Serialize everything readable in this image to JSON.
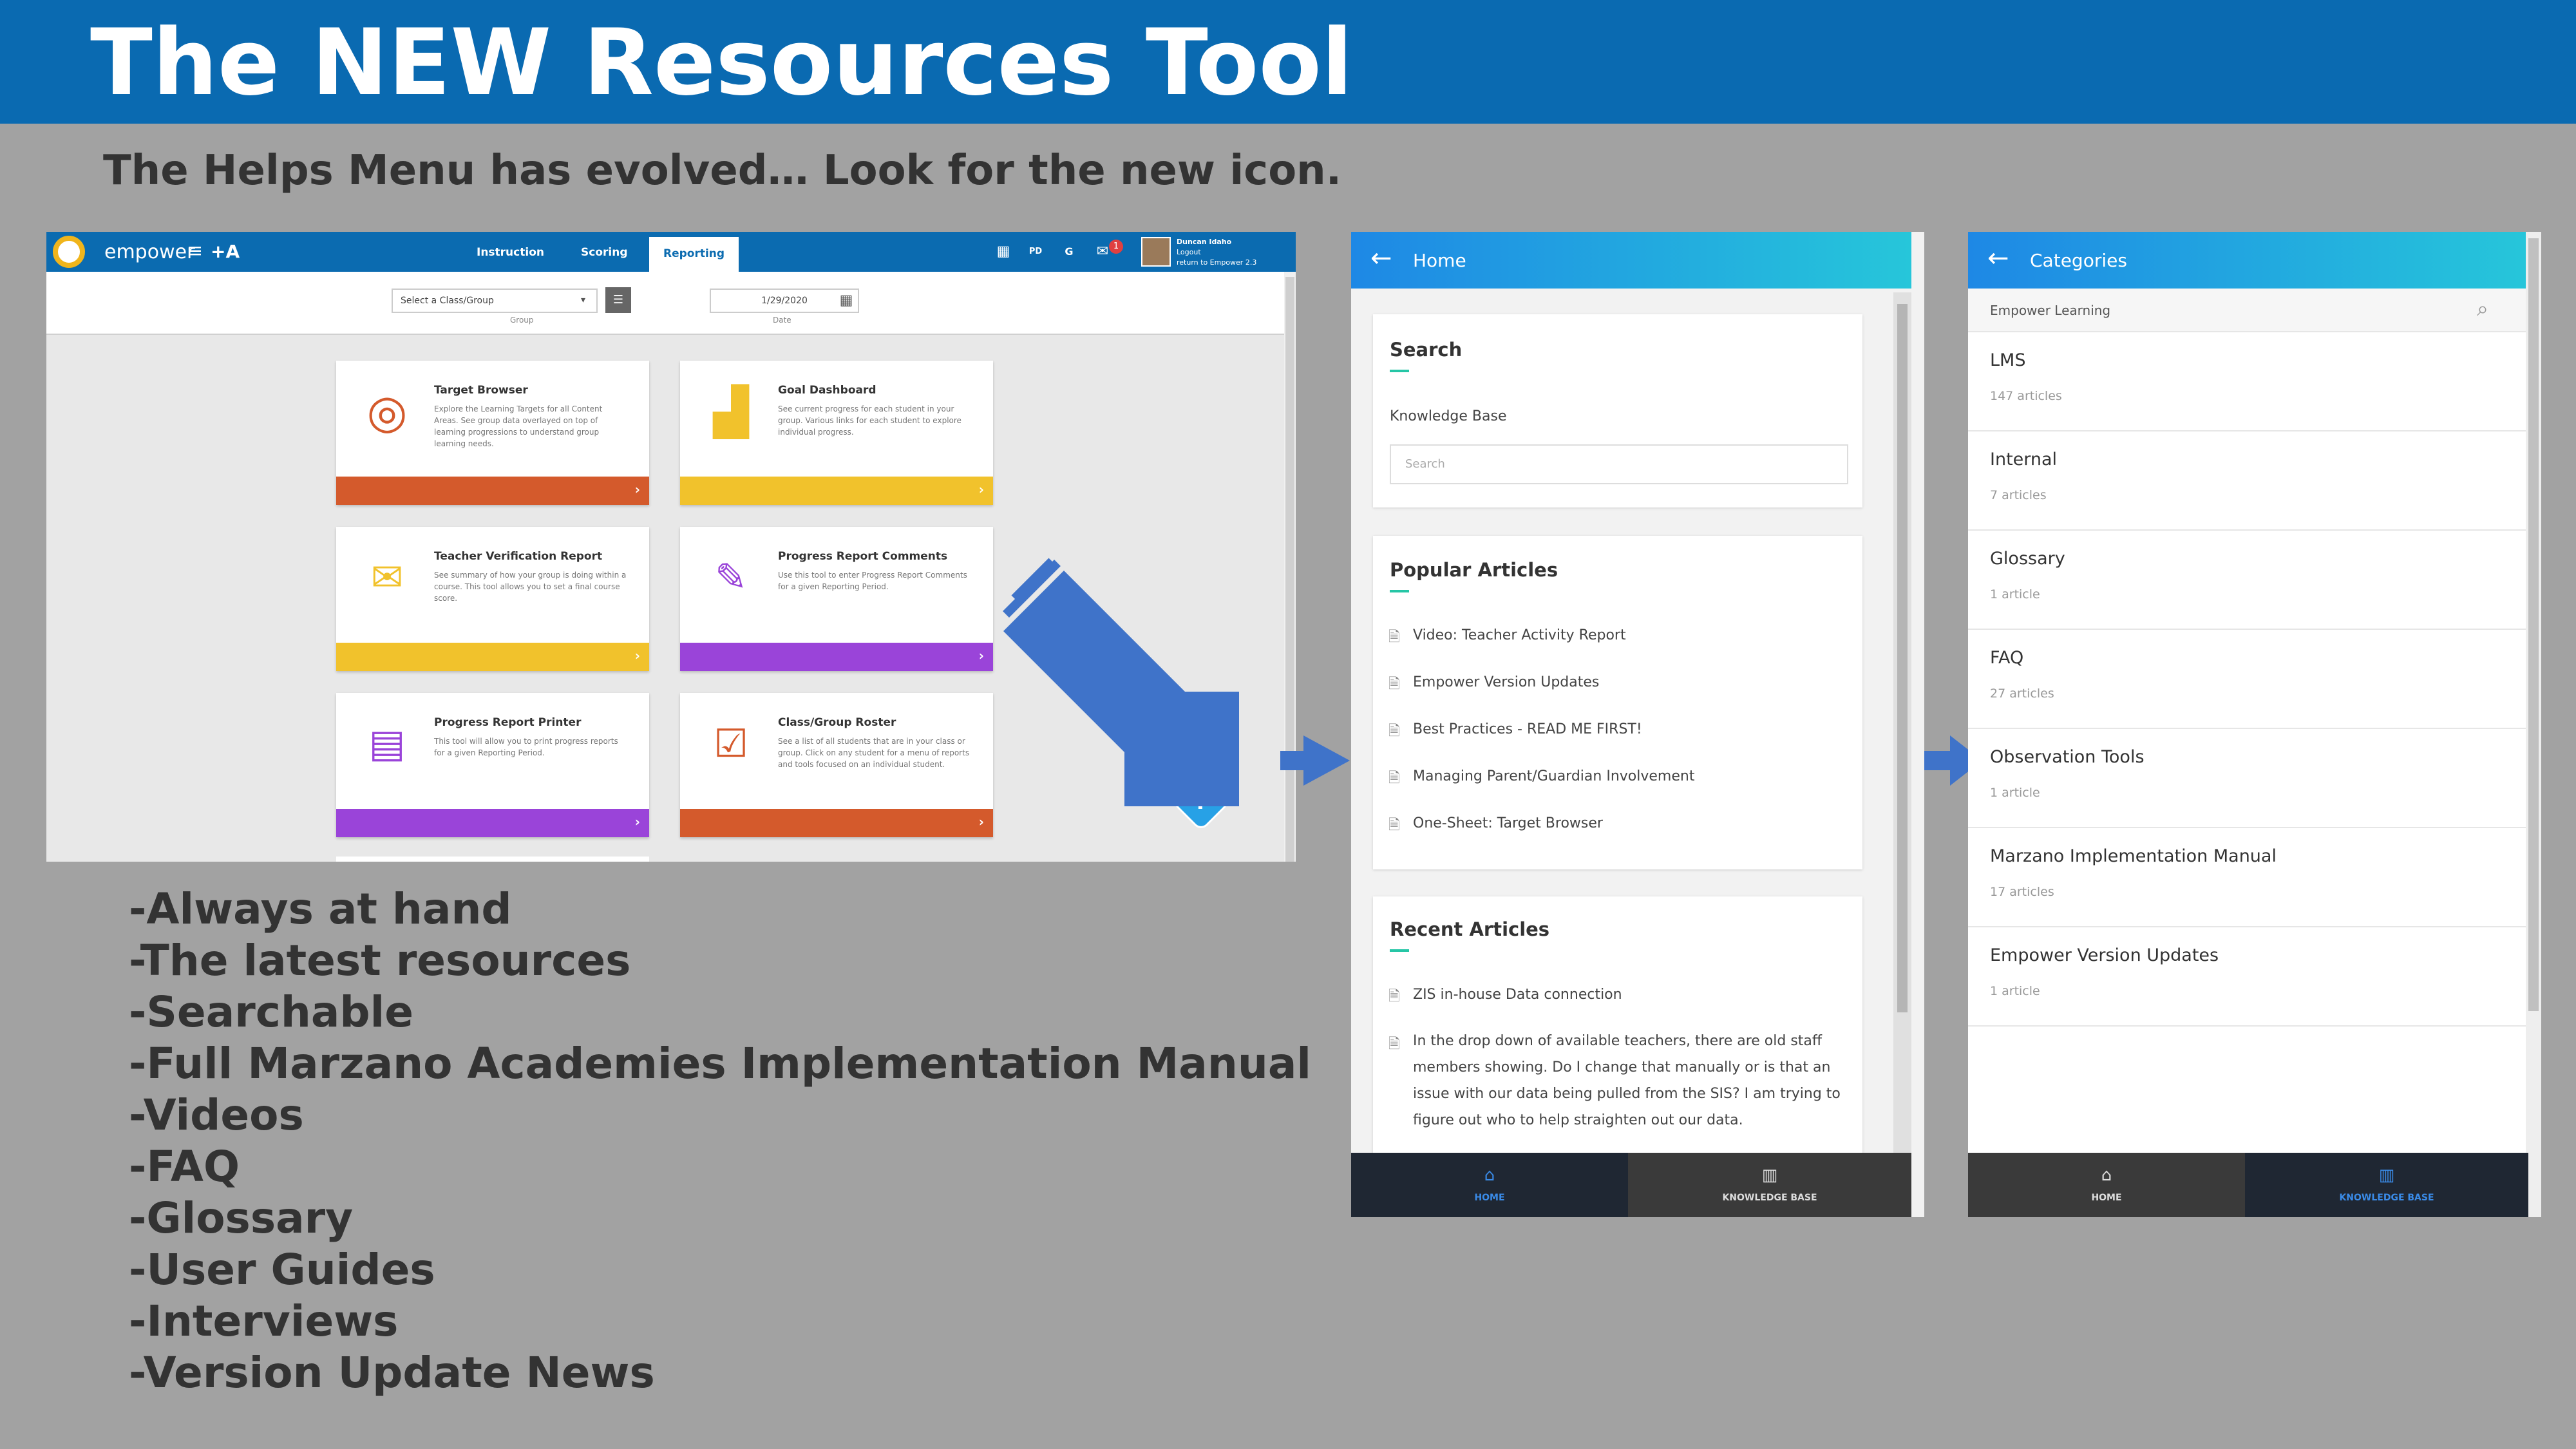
{
  "slide": {
    "title": "The NEW Resources Tool",
    "subtitle": "The Helps Menu has evolved…  Look for the new icon.",
    "bullets": [
      "-Always at hand",
      "-The latest resources",
      "-Searchable",
      "-Full Marzano Academies Implementation Manual",
      "-Videos",
      "-FAQ",
      "-Glossary",
      "-User Guides",
      "-Interviews",
      "-Version Update News"
    ]
  },
  "app": {
    "logo": "empower",
    "plus_a": "+A",
    "nav_tabs": [
      "Instruction",
      "Scoring",
      "Reporting"
    ],
    "active_tab": "Reporting",
    "badge_count": "1",
    "icon_badge_1": "PD",
    "icon_badge_2": "G",
    "user": {
      "name": "Duncan Idaho",
      "logout": "Logout",
      "return": "return to Empower 2.3"
    },
    "filters": {
      "group_value": "Select a Class/Group",
      "group_caption": "Group",
      "date_value": "1/29/2020",
      "date_caption": "Date"
    },
    "cards": [
      {
        "title": "Target Browser",
        "desc": "Explore the Learning Targets for all Content Areas. See group data overlayed on top of learning progressions to understand group learning needs.",
        "icon": "target-icon"
      },
      {
        "title": "Goal Dashboard",
        "desc": "See current progress for each student in your group. Various links for each student to explore individual progress.",
        "icon": "chart-icon"
      },
      {
        "title": "Teacher Verification Report",
        "desc": "See summary of how your group is doing within a course. This tool allows you to set a final course score.",
        "icon": "message-check-icon"
      },
      {
        "title": "Progress Report Comments",
        "desc": "Use this tool to enter Progress Report Comments for a given Reporting Period.",
        "icon": "comment-edit-icon"
      },
      {
        "title": "Progress Report Printer",
        "desc": "This tool will allow you to print progress reports for a given Reporting Period.",
        "icon": "report-icon"
      },
      {
        "title": "Class/Group Roster",
        "desc": "See a list of all students that are in your class or group. Click on any student for a menu of reports and tools focused on an individual student.",
        "icon": "roster-icon"
      }
    ],
    "help_label": "?"
  },
  "kb_home": {
    "header": "Home",
    "search_title": "Search",
    "search_label": "Knowledge Base",
    "search_placeholder": "Search",
    "popular_title": "Popular Articles",
    "popular": [
      "Video: Teacher Activity Report",
      "Empower Version Updates",
      "Best Practices - READ ME FIRST!",
      "Managing Parent/Guardian Involvement",
      "One-Sheet: Target Browser"
    ],
    "recent_title": "Recent Articles",
    "recent": [
      "ZIS in-house Data connection",
      "In the drop down of available teachers, there are old staff members showing. Do I change that manually or is that an issue with our data being pulled from the SIS? I am trying to figure out who to help straighten out our data."
    ],
    "footer": {
      "home": "HOME",
      "kb": "KNOWLEDGE BASE"
    }
  },
  "kb_categories": {
    "header": "Categories",
    "breadcrumb": "Empower Learning",
    "items": [
      {
        "name": "LMS",
        "count": "147 articles"
      },
      {
        "name": "Internal",
        "count": "7 articles"
      },
      {
        "name": "Glossary",
        "count": "1 article"
      },
      {
        "name": "FAQ",
        "count": "27 articles"
      },
      {
        "name": "Observation Tools",
        "count": "1 article"
      },
      {
        "name": "Marzano Implementation Manual",
        "count": "17 articles"
      },
      {
        "name": "Empower Version Updates",
        "count": "1 article"
      }
    ],
    "footer": {
      "home": "HOME",
      "kb": "KNOWLEDGE BASE"
    }
  },
  "colors": {
    "banner": "#0a6ab1",
    "background": "#a2a2a2",
    "card_orange": "#d45a2c",
    "card_yellow": "#f1c22c",
    "card_purple": "#9a44d9",
    "arrow_blue": "#3f73c9"
  }
}
